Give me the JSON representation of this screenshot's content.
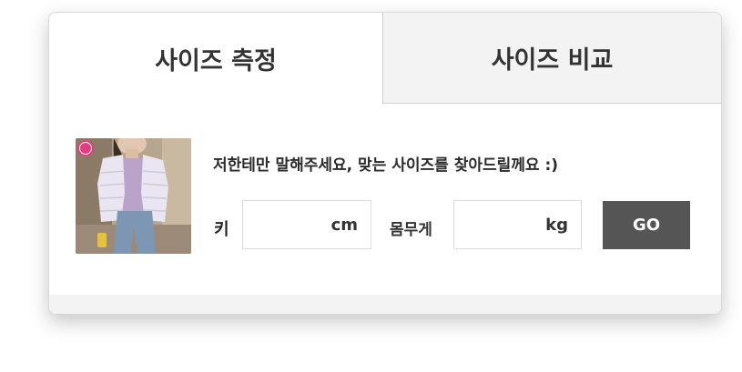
{
  "tabs": [
    {
      "label": "사이즈 측정",
      "active": true
    },
    {
      "label": "사이즈 비교",
      "active": false
    }
  ],
  "prompt": "저한테만 말해주세요, 맞는 사이즈를 찾아드릴께요 :)",
  "height_field": {
    "label": "키",
    "unit": "cm",
    "value": "",
    "placeholder": ""
  },
  "weight_field": {
    "label": "몸무게",
    "unit": "kg",
    "value": "",
    "placeholder": ""
  },
  "go_button": {
    "label": "GO"
  },
  "colors": {
    "button_bg": "#555555",
    "inactive_tab_bg": "#f3f3f3",
    "text": "#333333"
  }
}
